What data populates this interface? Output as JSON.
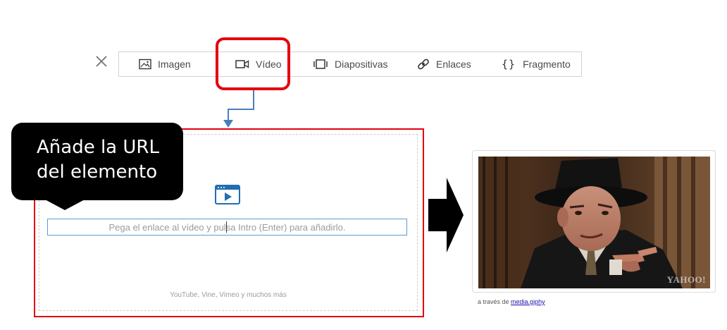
{
  "toolbar": {
    "close_icon": "close-icon",
    "items": [
      {
        "label": "Imagen",
        "icon": "image-icon"
      },
      {
        "label": "Vídeo",
        "icon": "video-camera-icon"
      },
      {
        "label": "Diapositivas",
        "icon": "slides-icon"
      },
      {
        "label": "Enlaces",
        "icon": "link-icon"
      },
      {
        "label": "Fragmento",
        "icon": "code-braces-icon",
        "glyph": "{}"
      }
    ],
    "highlighted_item": "Vídeo",
    "highlight_color": "#e4000f"
  },
  "panel": {
    "callout_line1": "Añade la URL",
    "callout_line2": "del elemento",
    "input_placeholder": "Pega el enlace al vídeo y pulsa Intro (Enter) para añadirlo.",
    "sources_note": "YouTube, Vine, Vimeo y muchos más",
    "border_color": "#e4000f",
    "input_border_color": "#5b9bd5",
    "connector_color": "#4a7ebb"
  },
  "result": {
    "watermark": "YAHOO!",
    "via_prefix": "a través de",
    "via_link": "media.giphy"
  }
}
